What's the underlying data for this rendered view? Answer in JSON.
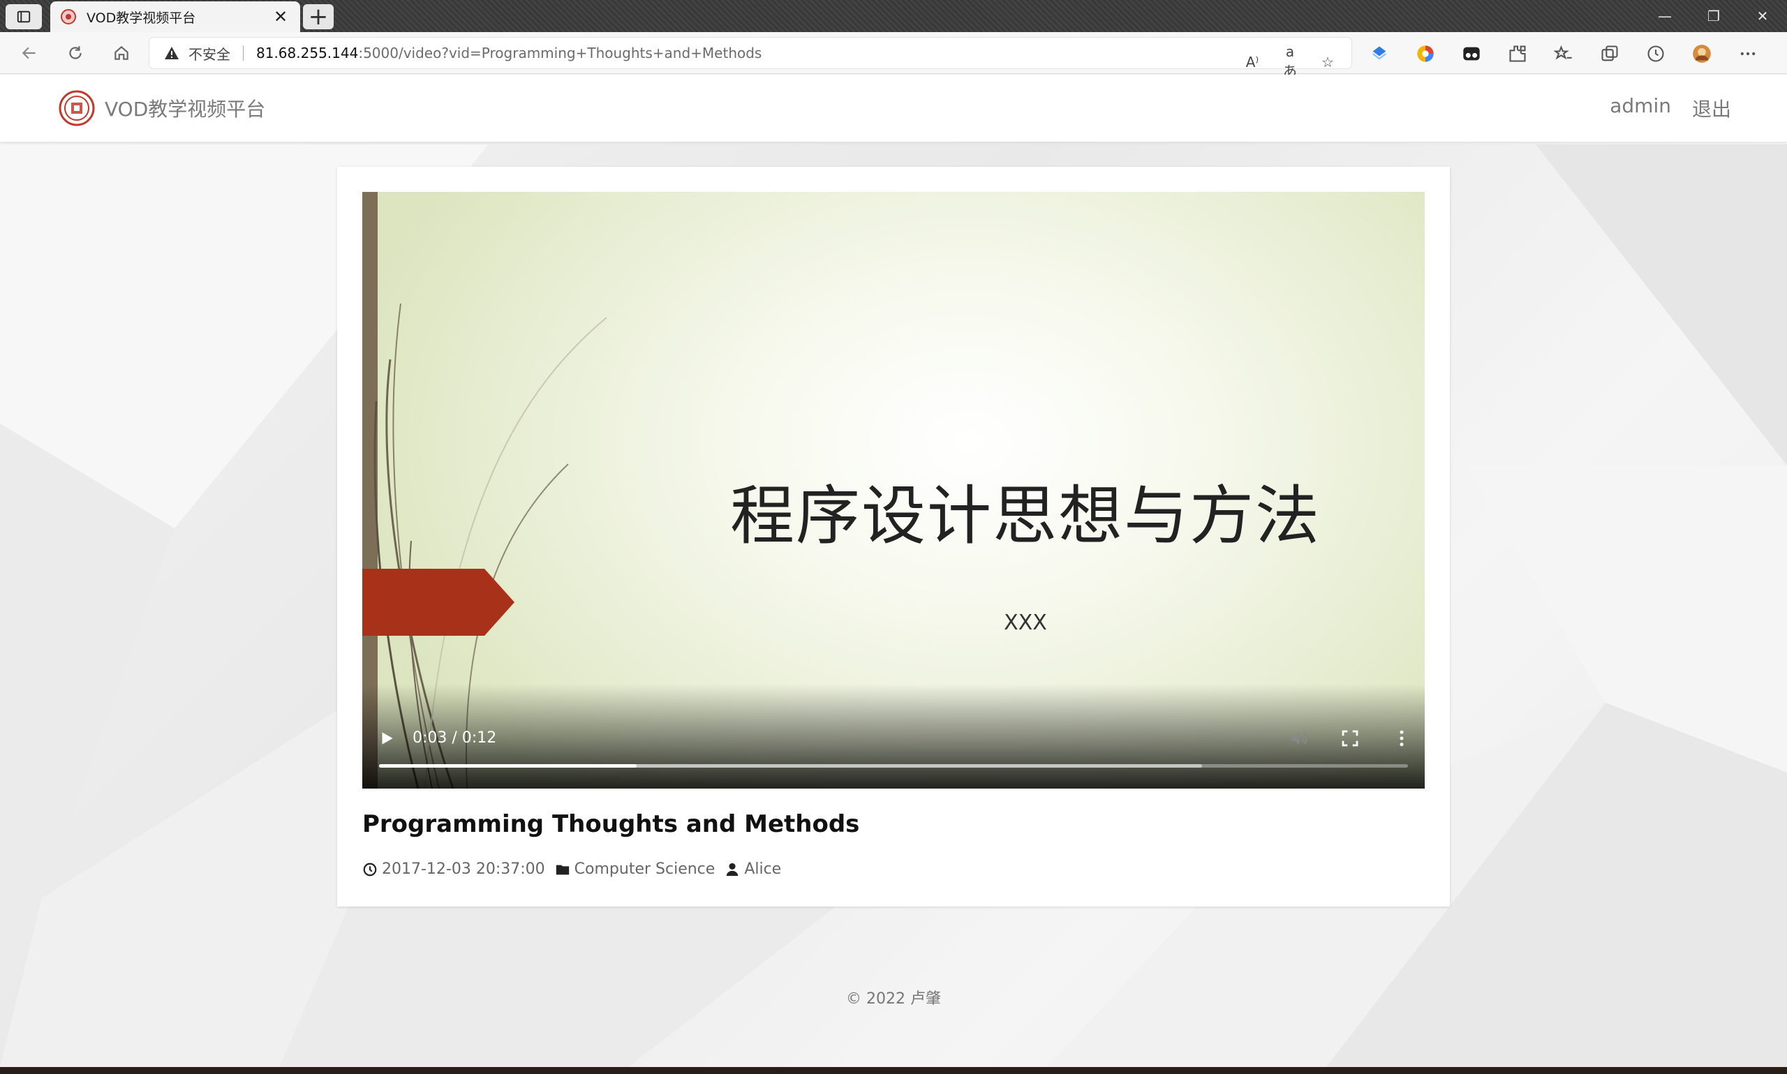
{
  "browser": {
    "tab_title": "VOD教学视频平台",
    "tab_close": "✕",
    "new_tab": "+",
    "security_text": "不安全",
    "url_host": "81.68.255.144",
    "url_rest": ":5000/video?vid=Programming+Thoughts+and+Methods",
    "window_minimize": "—",
    "window_restore": "❐",
    "window_close": "✕",
    "omnibox_icons": [
      "A⁾",
      "aあ",
      "☆"
    ]
  },
  "navbar": {
    "brand_name": "VOD教学视频平台",
    "user": "admin",
    "logout": "退出"
  },
  "video": {
    "slide_title": "程序设计思想与方法",
    "slide_subtitle": "XXX",
    "time_display": "0:03 / 0:12",
    "played_fraction": 0.25,
    "buffered_fraction": 0.8,
    "title": "Programming Thoughts and Methods",
    "datetime": "2017-12-03 20:37:00",
    "category": "Computer Science",
    "author": "Alice"
  },
  "footer": {
    "copyright": "© 2022 卢肇"
  },
  "colors": {
    "ribbon": "#a8311a",
    "slide_bar": "#7d6f57"
  }
}
